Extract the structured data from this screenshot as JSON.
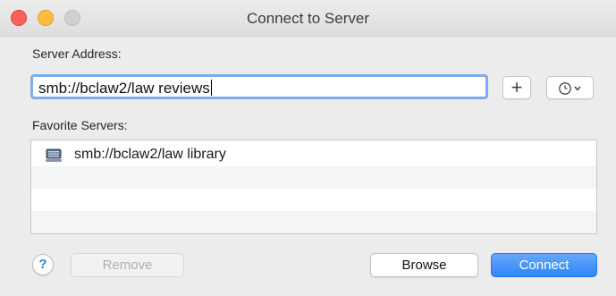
{
  "window": {
    "title": "Connect to Server"
  },
  "address": {
    "label": "Server Address:",
    "value": "smb://bclaw2/law reviews"
  },
  "favorites": {
    "label": "Favorite Servers:",
    "items": [
      {
        "label": "smb://bclaw2/law library",
        "icon": "server-icon"
      }
    ]
  },
  "buttons": {
    "add": "+",
    "help": "?",
    "remove": "Remove",
    "browse": "Browse",
    "connect": "Connect"
  },
  "colors": {
    "accent": "#2f84f6",
    "focus_ring": "#7bacf0"
  }
}
